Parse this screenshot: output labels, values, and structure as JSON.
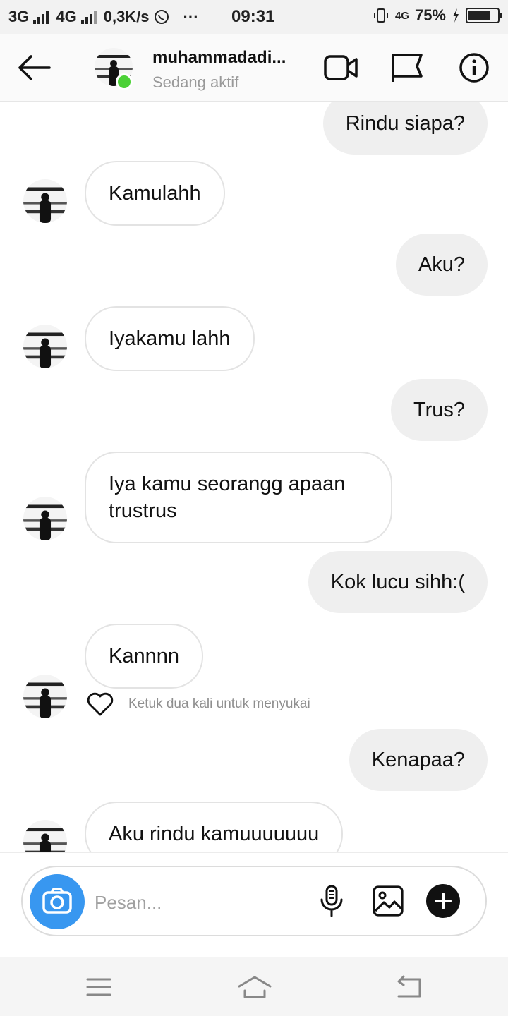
{
  "status_bar": {
    "net1": "3G",
    "net2": "4G",
    "speed": "0,3K/s",
    "dots": "···",
    "time": "09:31",
    "net_type": "4G",
    "battery": "75%",
    "battery_level": 0.75,
    "icons": [
      "signal-icon",
      "whatsapp-icon",
      "vibrate-icon",
      "charging-icon",
      "battery-icon"
    ]
  },
  "header": {
    "back_icon": "arrow-left-icon",
    "username": "muhammadadi...",
    "status": "Sedang aktif",
    "actions": [
      "video-call-icon",
      "flag-icon",
      "info-icon"
    ]
  },
  "messages": [
    {
      "from": "me",
      "text": "Rindu siapa?"
    },
    {
      "from": "them",
      "text": "Kamulahh"
    },
    {
      "from": "me",
      "text": "Aku?"
    },
    {
      "from": "them",
      "text": "Iyakamu lahh"
    },
    {
      "from": "me",
      "text": "Trus?"
    },
    {
      "from": "them",
      "text": "Iya kamu seorangg apaan trustrus"
    },
    {
      "from": "me",
      "text": "Kok lucu sihh:("
    },
    {
      "from": "them",
      "text": "Kannnn",
      "like_hint": "Ketuk dua kali untuk menyukai"
    },
    {
      "from": "me",
      "text": "Kenapaa?"
    },
    {
      "from": "them",
      "text": "Aku rindu kamuuuuuuu"
    }
  ],
  "composer": {
    "placeholder": "Pesan...",
    "icons": [
      "camera-icon",
      "microphone-icon",
      "gallery-icon",
      "plus-icon"
    ],
    "accent": "#3897f0"
  },
  "nav_bar": {
    "icons": [
      "menu-icon",
      "home-icon",
      "back-nav-icon"
    ]
  },
  "colors": {
    "online": "#4cd137",
    "my_bubble": "#efefef",
    "their_bubble_border": "#e3e3e3"
  }
}
